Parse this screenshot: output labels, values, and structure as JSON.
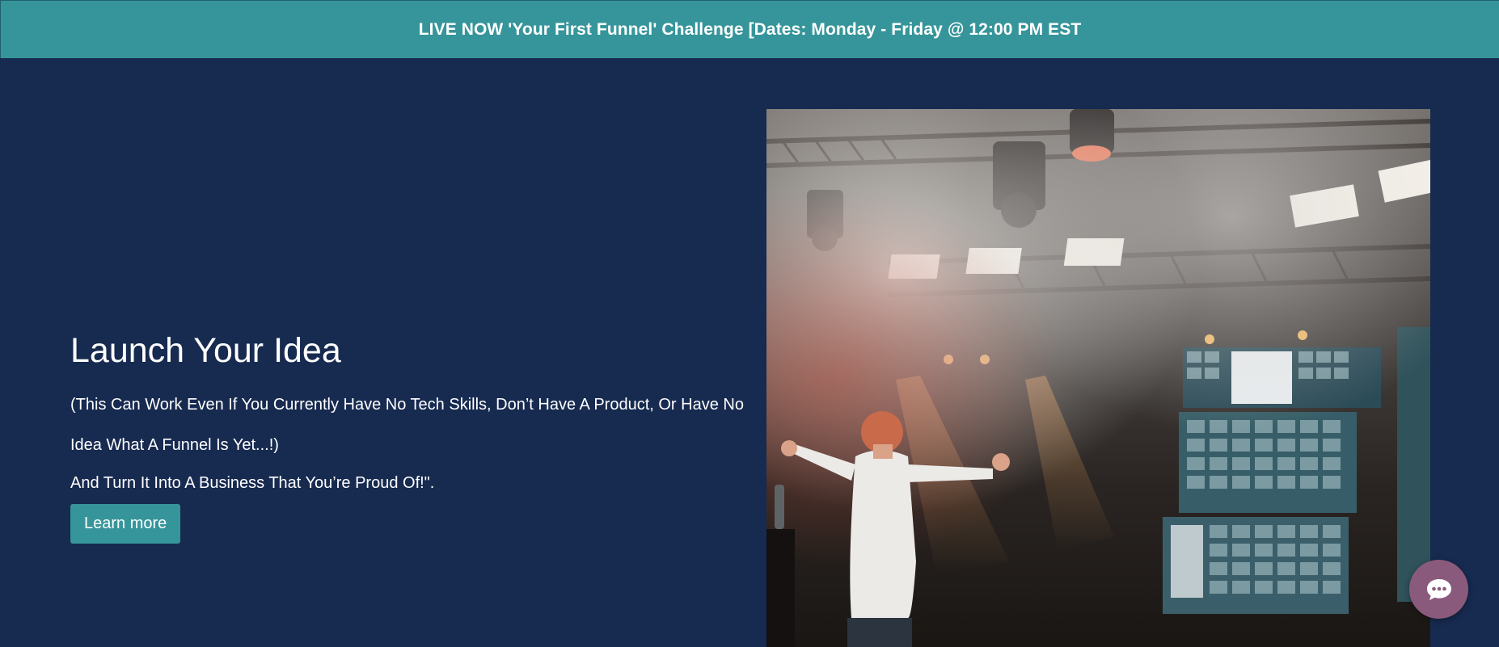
{
  "announcement": {
    "text": "LIVE NOW 'Your First Funnel' Challenge [Dates: Monday - Friday @ 12:00 PM EST"
  },
  "hero": {
    "title": "Launch Your Idea",
    "subtitle": "(This Can Work Even If You Currently Have No Tech Skills, Don’t Have A Product, Or Have No Idea What A Funnel Is Yet...!)",
    "tagline": "And Turn It Into A Business That You’re Proud Of!\".",
    "button_label": "Learn more"
  },
  "chat": {
    "icon": "chat-bubble-icon"
  },
  "colors": {
    "background": "#172a50",
    "accent": "#36959a",
    "chat_button": "#8a5a7c",
    "text": "#ffffff"
  }
}
